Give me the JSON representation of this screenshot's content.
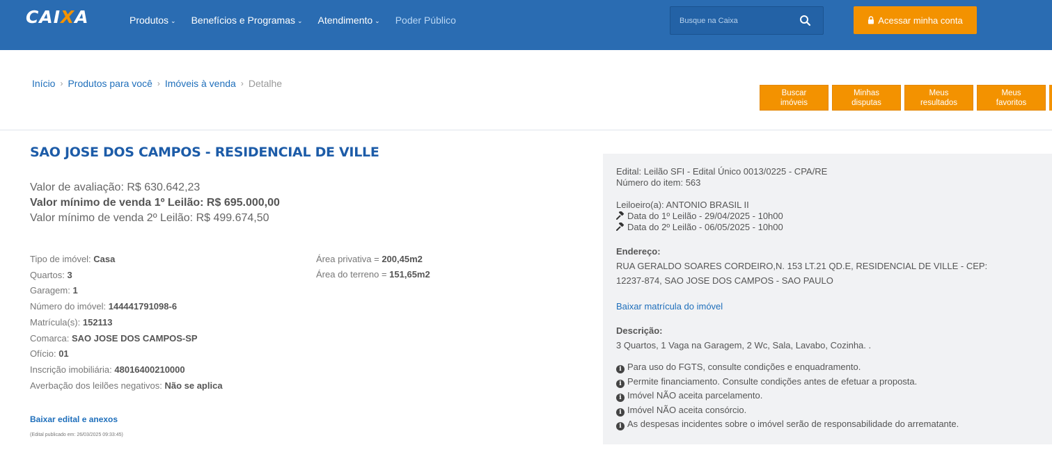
{
  "header": {
    "logo_left": "CAI",
    "logo_x": "X",
    "logo_right": "A",
    "nav": [
      {
        "label": "Produtos",
        "has_dropdown": true
      },
      {
        "label": "Benefícios e Programas",
        "has_dropdown": true
      },
      {
        "label": "Atendimento",
        "has_dropdown": true
      },
      {
        "label": "Poder Público",
        "has_dropdown": false
      }
    ],
    "search_placeholder": "Busque na Caixa",
    "account_button": "Acessar minha conta",
    "colors": {
      "bar": "#2a6cb2",
      "accent": "#f39200"
    }
  },
  "breadcrumb": {
    "items": [
      "Início",
      "Produtos para você",
      "Imóveis à venda"
    ],
    "current": "Detalhe"
  },
  "actions": [
    {
      "line1": "Buscar",
      "line2": "imóveis"
    },
    {
      "line1": "Minhas",
      "line2": "disputas"
    },
    {
      "line1": "Meus",
      "line2": "resultados"
    },
    {
      "line1": "Meus",
      "line2": "favoritos"
    }
  ],
  "property": {
    "title": "SAO JOSE DOS CAMPOS - RESIDENCIAL DE VILLE",
    "valor_avaliacao": "Valor de avaliação: R$ 630.642,23",
    "valor_1_leilao": "Valor mínimo de venda 1º Leilão: R$ 695.000,00",
    "valor_2_leilao": "Valor mínimo de venda 2º Leilão: R$ 499.674,50",
    "details": [
      {
        "label": "Tipo de imóvel:",
        "value": "Casa"
      },
      {
        "label": "Quartos:",
        "value": "3"
      },
      {
        "label": "Garagem:",
        "value": "1"
      },
      {
        "label": "Número do imóvel:",
        "value": "144441791098-6"
      },
      {
        "label": "Matrícula(s):",
        "value": "152113"
      },
      {
        "label": "Comarca:",
        "value": "SAO JOSE DOS CAMPOS-SP"
      },
      {
        "label": "Ofício:",
        "value": "01"
      },
      {
        "label": "Inscrição imobiliária:",
        "value": "48016400210000"
      },
      {
        "label": "Averbação dos leilões negativos:",
        "value": "Não se aplica"
      }
    ],
    "areas": [
      {
        "label": "Área privativa =",
        "value": "200,45m2"
      },
      {
        "label": "Área do terreno =",
        "value": "151,65m2"
      }
    ],
    "download_edital": "Baixar edital e anexos",
    "edital_date": "(Edital publicado em: 26/03/2025 09:33:45)"
  },
  "panel": {
    "edital": "Edital: Leilão SFI - Edital Único 0013/0225 - CPA/RE",
    "item": "Número do item: 563",
    "leiloeiro": "Leiloeiro(a): ANTONIO BRASIL II",
    "data_1": "Data do 1º Leilão - 29/04/2025 - 10h00",
    "data_2": "Data do 2º Leilão - 06/05/2025 - 10h00",
    "endereco_label": "Endereço:",
    "endereco_1": "RUA GERALDO SOARES CORDEIRO,N. 153 LT.21 QD.E, RESIDENCIAL DE VILLE - CEP:",
    "endereco_2": "12237-874, SAO JOSE DOS CAMPOS - SAO PAULO",
    "matricula_link": "Baixar matrícula do imóvel",
    "descricao_label": "Descrição:",
    "descricao": "3 Quartos, 1 Vaga na Garagem, 2 Wc, Sala, Lavabo, Cozinha. .",
    "notes": [
      "Para uso do FGTS, consulte condições e enquadramento.",
      "Permite financiamento. Consulte condições antes de efetuar a proposta.",
      "Imóvel NÃO aceita parcelamento.",
      "Imóvel NÃO aceita consórcio.",
      "As despesas incidentes sobre o imóvel serão de responsabilidade do arrematante."
    ]
  }
}
